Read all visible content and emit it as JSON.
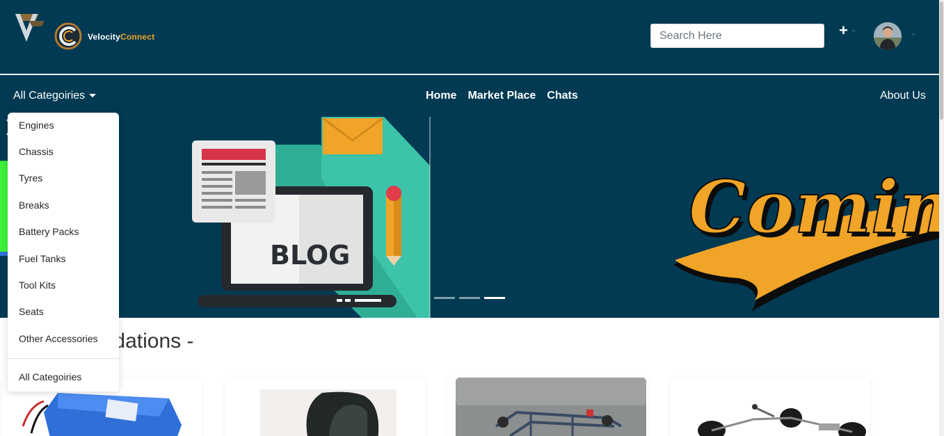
{
  "header": {
    "brand_prefix": "Velocity",
    "brand_suffix": "Connect",
    "search_placeholder": "Search Here",
    "plus_label": "+"
  },
  "nav": {
    "categories_toggle": "All Categoiries",
    "links": [
      "Home",
      "Market Place",
      "Chats"
    ],
    "about": "About Us"
  },
  "dropdown": {
    "items": [
      "Engines",
      "Chassis",
      "Tyres",
      "Breaks",
      "Battery Packs",
      "Fuel Tanks",
      "Tool Kits",
      "Seats",
      "Other Accessories"
    ],
    "footer_item": "All Categoiries"
  },
  "carousel": {
    "blog_text": "BLOG",
    "coming_text": "Coming",
    "left_letter": "R",
    "slide_count": 3,
    "active_slide": 3
  },
  "main": {
    "section_title": "Recommendations -"
  },
  "colors": {
    "header_bg": "#013a52",
    "accent": "#f0a428"
  }
}
